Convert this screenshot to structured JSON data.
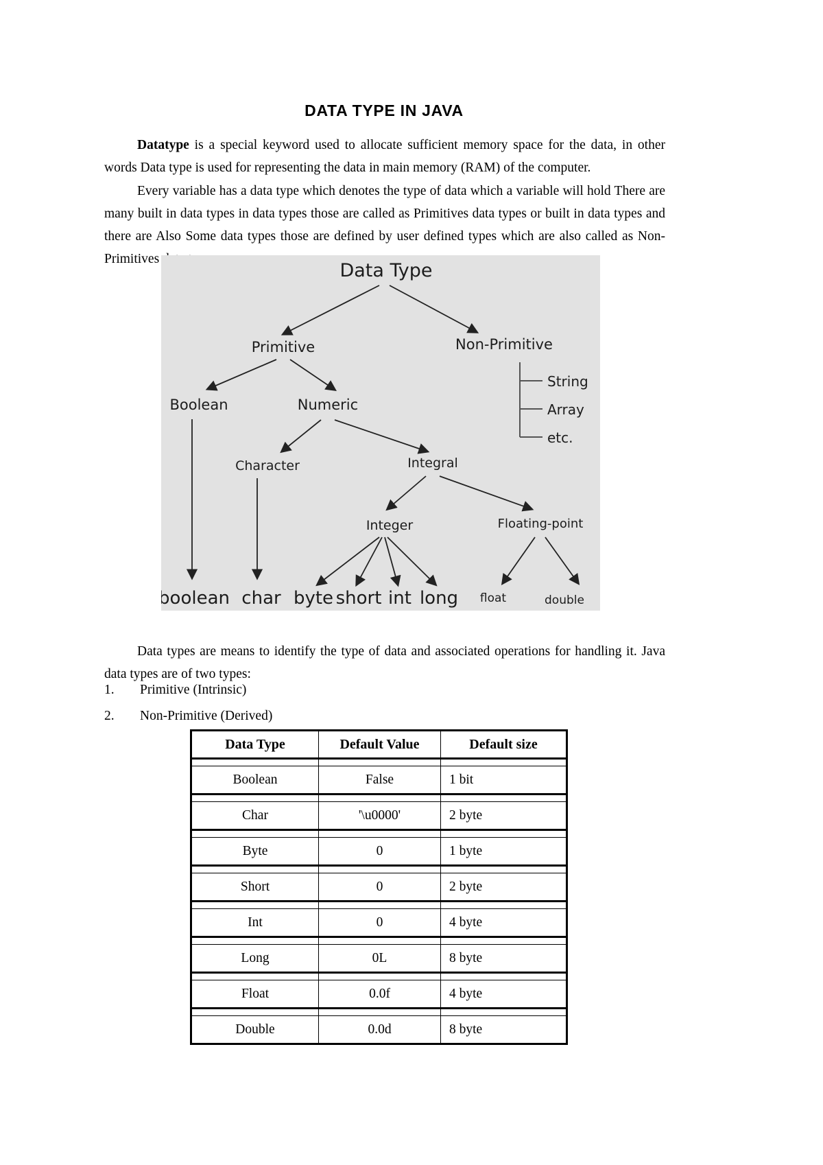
{
  "document": {
    "title": "DATA TYPE IN JAVA",
    "paragraphs": [
      {
        "id": "p1",
        "lead": "Datatype",
        "text": " is a special keyword used to allocate sufficient memory space for the data, in other words Data type is used for representing the data in main memory (RAM) of the computer."
      },
      {
        "id": "p2",
        "lead": "",
        "text": "Every variable has a data type which denotes the type of data which a variable will hold There are many built in data types in data types those are called as Primitives data types or built in data types and there are Also Some data types those are defined by user defined types which are also called as Non-Primitives data types."
      },
      {
        "id": "p3",
        "lead": "",
        "text": "Data types are means to identify the type of data and associated operations for handling it. Java data types are of two types:"
      }
    ],
    "list": [
      {
        "number": "1.",
        "label": "Primitive (Intrinsic)"
      },
      {
        "number": "2.",
        "label": "Non-Primitive (Derived)"
      }
    ]
  },
  "diagram": {
    "background_color": "#e2e2e2",
    "nodes": {
      "root": "Data Type",
      "primitive": "Primitive",
      "non_primitive": "Non-Primitive",
      "boolean": "Boolean",
      "numeric": "Numeric",
      "character": "Character",
      "integral": "Integral",
      "integer": "Integer",
      "floating_point": "Floating-point",
      "leaf_boolean": "boolean",
      "leaf_char": "char",
      "leaf_byte": "byte",
      "leaf_short": "short",
      "leaf_int": "int",
      "leaf_long": "long",
      "leaf_float": "float",
      "leaf_double": "double",
      "np_string": "String",
      "np_array": "Array",
      "np_etc": "etc."
    }
  },
  "table": {
    "headers": [
      "Data Type",
      "Default Value",
      "Default size"
    ],
    "rows": [
      {
        "type": "Boolean",
        "value": "False",
        "size": "1 bit"
      },
      {
        "type": "Char",
        "value": "'\\u0000'",
        "size": "2 byte"
      },
      {
        "type": "Byte",
        "value": "0",
        "size": "1 byte"
      },
      {
        "type": "Short",
        "value": "0",
        "size": "2 byte"
      },
      {
        "type": "Int",
        "value": "0",
        "size": "4 byte"
      },
      {
        "type": "Long",
        "value": "0L",
        "size": "8 byte"
      },
      {
        "type": "Float",
        "value": "0.0f",
        "size": "4 byte"
      },
      {
        "type": "Double",
        "value": "0.0d",
        "size": "8 byte"
      }
    ]
  }
}
